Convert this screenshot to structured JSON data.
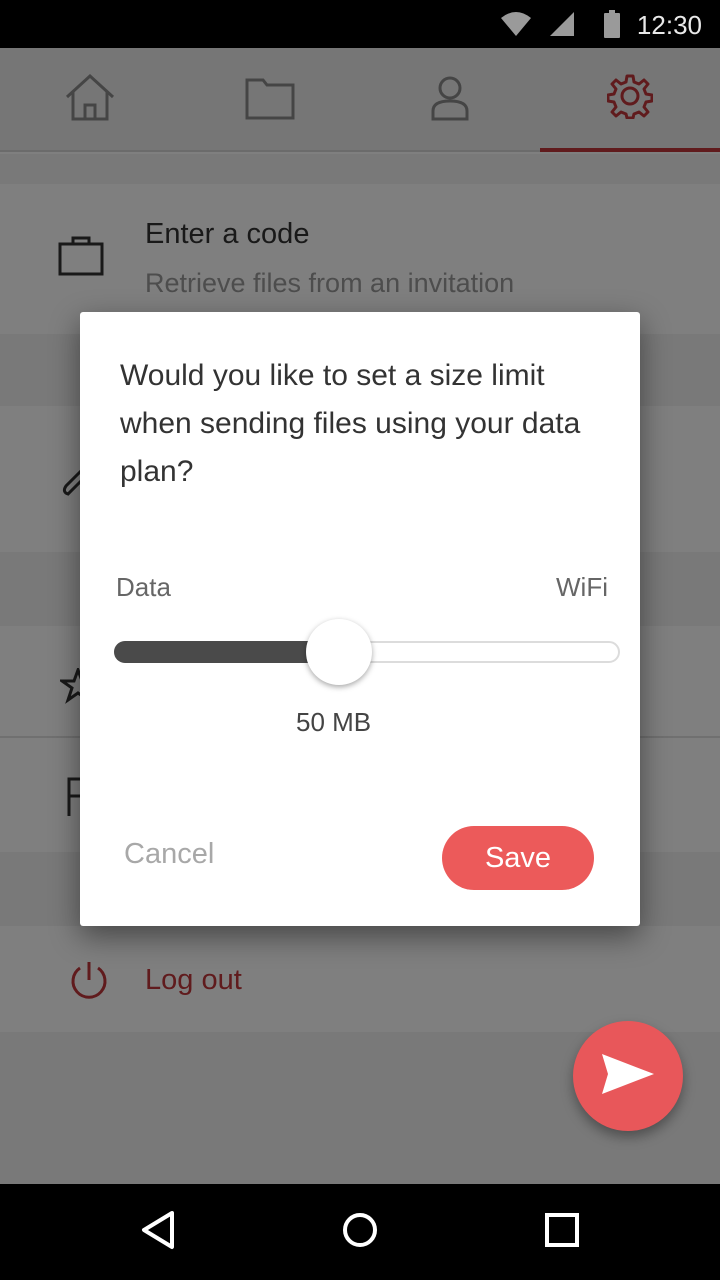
{
  "status_bar": {
    "time": "12:30",
    "icons": [
      "wifi-icon",
      "signal-icon",
      "battery-icon"
    ]
  },
  "tabs": [
    {
      "name": "home",
      "icon": "home-icon",
      "active": false
    },
    {
      "name": "files",
      "icon": "folder-icon",
      "active": false
    },
    {
      "name": "profile",
      "icon": "person-icon",
      "active": false
    },
    {
      "name": "settings",
      "icon": "gear-icon",
      "active": true
    }
  ],
  "list": {
    "enter_code_title": "Enter a code",
    "enter_code_subtitle": "Retrieve files from an invitation",
    "logout_label": "Log out"
  },
  "dialog": {
    "question": "Would you like to set a size limit when sending files using your data plan?",
    "left_label": "Data",
    "right_label": "WiFi",
    "value": "50 MB",
    "slider_fraction": 0.445,
    "cancel_label": "Cancel",
    "save_label": "Save"
  },
  "colors": {
    "accent": "#ec5a5a",
    "dark_accent": "#c0363a"
  }
}
